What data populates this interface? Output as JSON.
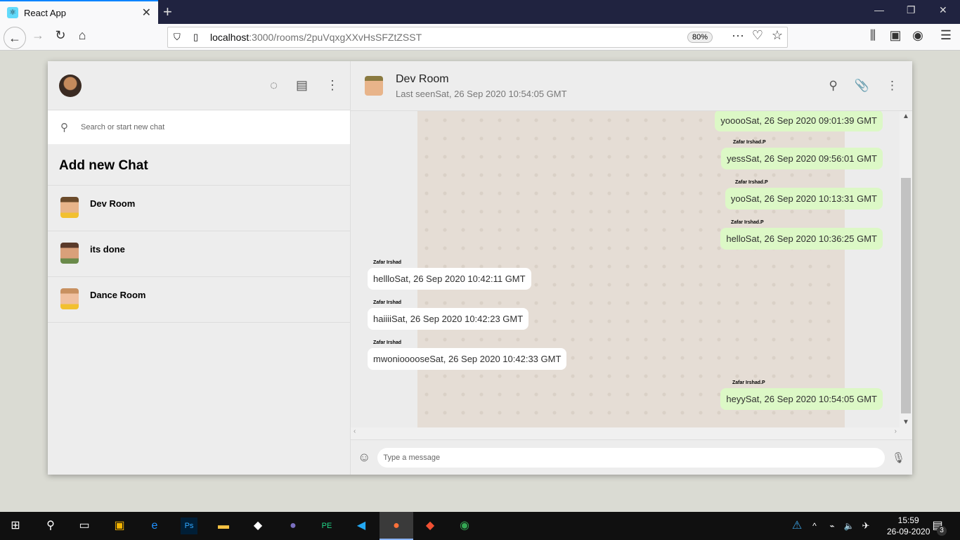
{
  "browser": {
    "tab_title": "React App",
    "url_host": "localhost",
    "url_path": ":3000/rooms/2puVqxgXXvHsSFZtZSST",
    "zoom": "80%"
  },
  "sidebar": {
    "search_placeholder": "Search or start new chat",
    "add_new": "Add new Chat",
    "rooms": [
      {
        "name": "Dev Room"
      },
      {
        "name": "its done"
      },
      {
        "name": "Dance Room"
      }
    ]
  },
  "chat": {
    "title": "Dev Room",
    "subtitle": "Last seenSat, 26 Sep 2020 10:54:05 GMT",
    "input_placeholder": "Type a message",
    "messages": [
      {
        "sender": "",
        "text": "yooooSat, 26 Sep 2020 09:01:39 GMT",
        "mine": true
      },
      {
        "sender": "Zafar Irshad.P",
        "text": "yessSat, 26 Sep 2020 09:56:01 GMT",
        "mine": true
      },
      {
        "sender": "Zafar Irshad.P",
        "text": "yooSat, 26 Sep 2020 10:13:31 GMT",
        "mine": true
      },
      {
        "sender": "Zafar Irshad.P",
        "text": "helloSat, 26 Sep 2020 10:36:25 GMT",
        "mine": true
      },
      {
        "sender": "Zafar Irshad",
        "text": "hellloSat, 26 Sep 2020 10:42:11 GMT",
        "mine": false
      },
      {
        "sender": "Zafar Irshad",
        "text": "haiiiiSat, 26 Sep 2020 10:42:23 GMT",
        "mine": false
      },
      {
        "sender": "Zafar Irshad",
        "text": "mwoniooooseSat, 26 Sep 2020 10:42:33 GMT",
        "mine": false
      },
      {
        "sender": "Zafar Irshad.P",
        "text": "heyySat, 26 Sep 2020 10:54:05 GMT",
        "mine": true
      }
    ]
  },
  "taskbar": {
    "time": "15:59",
    "date": "26-09-2020",
    "notifications": "3"
  }
}
